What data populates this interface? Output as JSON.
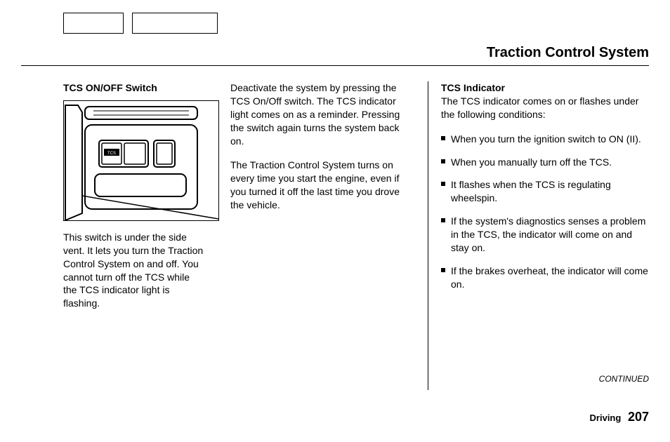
{
  "title": "Traction Control System",
  "col1": {
    "heading": "TCS ON/OFF Switch",
    "illustration_label": "TCS",
    "p1": "This switch is under the side vent. It lets you turn the Traction Control System on and off. You cannot turn off the TCS while the TCS indicator light is flashing."
  },
  "col2": {
    "p1": "Deactivate the system by pressing the TCS On/Off switch. The TCS indicator light comes on as a reminder. Pressing the switch again turns the system back on.",
    "p2": "The Traction Control System turns on every time you start the engine, even if you turned it off the last time you drove the vehicle."
  },
  "col3": {
    "heading": "TCS Indicator",
    "intro": "The TCS indicator comes on or flashes under the following condi­tions:",
    "bullets": [
      "When you turn the ignition switch to ON (II).",
      "When you manually turn off the TCS.",
      "It flashes when the TCS is regulating wheelspin.",
      "If the system's diagnostics senses a problem in the TCS, the indica­tor will come on and stay on.",
      "If the brakes overheat, the indicator will come on."
    ],
    "continued": "CONTINUED"
  },
  "footer": {
    "section": "Driving",
    "page": "207"
  }
}
